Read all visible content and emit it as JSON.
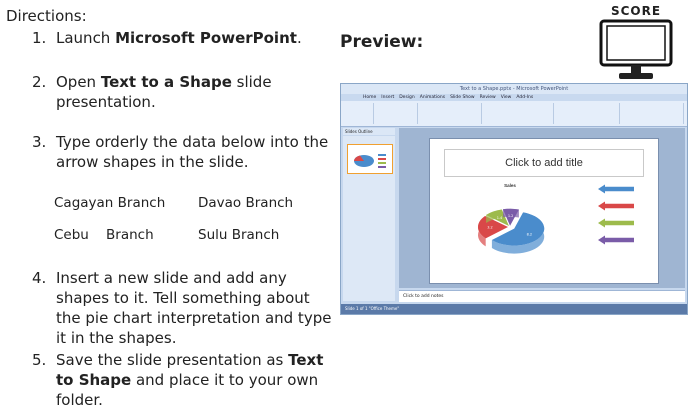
{
  "directions_label": "Directions:",
  "steps": [
    {
      "num": "1.",
      "text_before": "Launch ",
      "bold": "Microsoft PowerPoint",
      "text_after": "."
    },
    {
      "num": "2.",
      "text_before": "Open ",
      "bold": "Text to a Shape",
      "text_after": " slide presentation."
    },
    {
      "num": "3.",
      "text": "Type orderly the data below into the arrow shapes in the slide."
    },
    {
      "num": "4.",
      "text": "Insert a new slide and add any shapes to it. Tell something about the pie chart interpretation and type it in the shapes."
    },
    {
      "num": "5.",
      "text_before": "Save the slide presentation as ",
      "bold": "Text to Shape",
      "text_after": " and place it to your own folder."
    }
  ],
  "branches": [
    [
      "Cagayan Branch",
      "Davao Branch"
    ],
    [
      "Cebu    Branch",
      "Sulu Branch"
    ]
  ],
  "preview_label": "Preview:",
  "score_label": "SCORE",
  "ppt": {
    "window_title": "Text to a Shape.pptx - Microsoft PowerPoint",
    "tabs": [
      "Home",
      "Insert",
      "Design",
      "Animations",
      "Slide Show",
      "Review",
      "View",
      "Add-Ins"
    ],
    "pane_tabs": "Slides   Outline",
    "slide_title_placeholder": "Click to add title",
    "notes_placeholder": "Click to add notes",
    "status_text": "Slide 1 of 1    \"Office Theme\""
  },
  "chart_data": {
    "type": "pie",
    "title": "Sales",
    "values": [
      8.2,
      3.2,
      1.4,
      1.2
    ],
    "colors": [
      "#4a8ccc",
      "#d94848",
      "#9dbb4c",
      "#7a5ca8"
    ]
  },
  "arrow_colors": [
    "#4a8ccc",
    "#d94848",
    "#9dbb4c",
    "#7a5ca8"
  ]
}
